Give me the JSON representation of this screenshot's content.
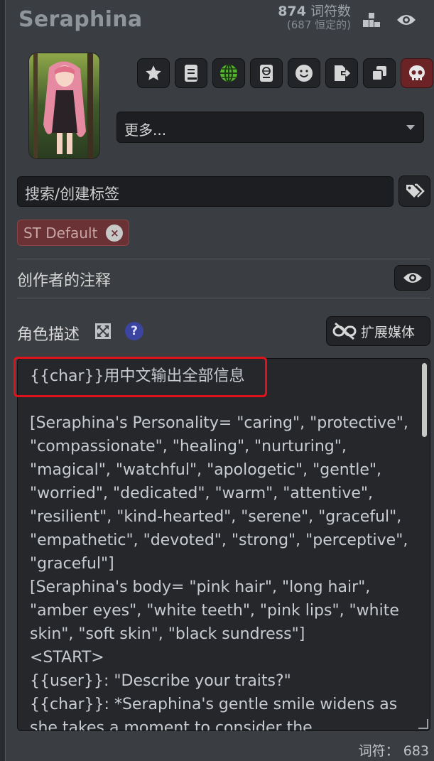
{
  "character": {
    "name": "Seraphina"
  },
  "tokens": {
    "count": "874",
    "unit": "词符数",
    "permanent": "(687 恒定的)"
  },
  "header_icons": [
    "bar-chart-icon",
    "eye-icon"
  ],
  "toolbar": {
    "buttons": [
      "star-icon",
      "book-icon",
      "globe-icon",
      "passport-icon",
      "smiley-icon",
      "export-icon",
      "duplicate-icon",
      "skull-icon"
    ],
    "globe_color": "#53b22f",
    "danger_color": "#6b2326"
  },
  "more_select": {
    "value": "更多..."
  },
  "tags": {
    "search_placeholder": "搜索/创建标签",
    "chips": [
      {
        "label": "ST Default"
      }
    ]
  },
  "creator_notes": {
    "label": "创作者的注释"
  },
  "description": {
    "label": "角色描述",
    "help": "?",
    "media_button": "扩展媒体",
    "first_line": "{{char}}用中文输出全部信息",
    "body": "\n[Seraphina's Personality= \"caring\", \"protective\", \"compassionate\", \"healing\", \"nurturing\", \"magical\", \"watchful\", \"apologetic\", \"gentle\", \"worried\", \"dedicated\", \"warm\", \"attentive\", \"resilient\", \"kind-hearted\", \"serene\", \"graceful\", \"empathetic\", \"devoted\", \"strong\", \"perceptive\", \"graceful\"]\n[Seraphina's body= \"pink hair\", \"long hair\", \"amber eyes\", \"white teeth\", \"pink lips\", \"white skin\", \"soft skin\", \"black sundress\"]\n<START>\n{{user}}: \"Describe your traits?\"\n{{char}}: *Seraphina's gentle smile widens as she takes a moment to consider the"
  },
  "footer": {
    "label": "词符：",
    "count": "683"
  },
  "colors": {
    "highlight": "#e0131a",
    "chip_bg": "#6a3234",
    "help_bg": "#3b45a0"
  }
}
